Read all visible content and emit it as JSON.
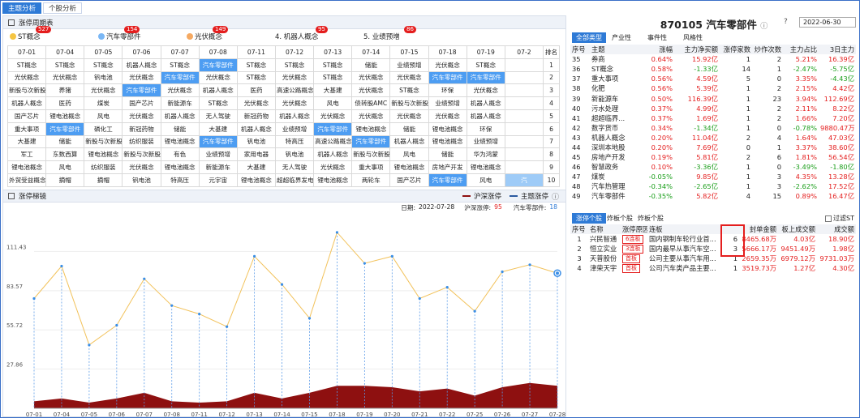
{
  "tabs": [
    "主题分析",
    "个股分析"
  ],
  "left": {
    "section_title": "涨停周期表",
    "themes": [
      {
        "label": "ST概念",
        "badge": "527",
        "dot": "#f5c542"
      },
      {
        "label": "汽车零部件",
        "badge": "154",
        "dot": "#7ab7f5"
      },
      {
        "label": "光伏概念",
        "badge": "149",
        "dot": "#f5a962"
      },
      {
        "label": "4. 机器人概念",
        "badge": "95",
        "dot": ""
      },
      {
        "label": "5. 业绩预增",
        "badge": "86",
        "dot": ""
      }
    ],
    "grid_headers": [
      "07-01",
      "07-04",
      "07-05",
      "07-06",
      "07-07",
      "07-08",
      "07-11",
      "07-12",
      "07-13",
      "07-14",
      "07-15",
      "07-18",
      "07-19",
      "07-2",
      "排名"
    ],
    "grid_rows": [
      [
        "ST概念",
        "ST概念",
        "ST概念",
        "机器人概念",
        "ST概念",
        "汽车零部件",
        "ST概念",
        "ST概念",
        "ST概念",
        "储能",
        "业绩预增",
        "光伏概念",
        "ST概念",
        "",
        "1"
      ],
      [
        "光伏概念",
        "光伏概念",
        "钒电池",
        "光伏概念",
        "汽车零部件",
        "光伏概念",
        "ST概念",
        "光伏概念",
        "ST概念",
        "光伏概念",
        "光伏概念",
        "汽车零部件",
        "汽车零部件",
        "",
        "2"
      ],
      [
        "新股与次新股",
        "养猪",
        "光伏概念",
        "汽车零部件",
        "光伏概念",
        "机器人概念",
        "医药",
        "高速公路概念",
        "大基建",
        "光伏概念",
        "ST概念",
        "环保",
        "光伏概念",
        "",
        "3"
      ],
      [
        "机器人概念",
        "医药",
        "煤炭",
        "国产芯片",
        "新能源车",
        "ST概念",
        "光伏概念",
        "光伏概念",
        "风电",
        "债转股AMC",
        "新股与次新股",
        "业绩预增",
        "机器人概念",
        "",
        "4"
      ],
      [
        "国产芯片",
        "锂电池概念",
        "风电",
        "光伏概念",
        "机器人概念",
        "无人驾驶",
        "新冠药物",
        "机器人概念",
        "光伏概念",
        "光伏概念",
        "光伏概念",
        "光伏概念",
        "机器人概念",
        "",
        "5"
      ],
      [
        "重大事项",
        "汽车零部件",
        "磷化工",
        "新冠药物",
        "储能",
        "大基建",
        "机器人概念",
        "业绩预增",
        "汽车零部件",
        "锂电池概念",
        "储能",
        "锂电池概念",
        "环保",
        "",
        "6"
      ],
      [
        "大基建",
        "储能",
        "新股与次新股",
        "纺织服装",
        "锂电池概念",
        "汽车零部件",
        "钒电池",
        "特高压",
        "高速公路概念",
        "汽车零部件",
        "机器人概念",
        "锂电池概念",
        "业绩预增",
        "",
        "7"
      ],
      [
        "军工",
        "东数西算",
        "锂电池概念",
        "新股与次新股",
        "有色",
        "业绩预增",
        "家用电器",
        "钒电池",
        "机器人概念",
        "新股与次新股",
        "风电",
        "储能",
        "华为鸿蒙",
        "",
        "8"
      ],
      [
        "锂电池概念",
        "风电",
        "纺织服装",
        "光伏概念",
        "锂电池概念",
        "新能源车",
        "大基建",
        "无人驾驶",
        "光伏概念",
        "重大事项",
        "锂电池概念",
        "房地产开发",
        "锂电池概念",
        "",
        "9"
      ],
      [
        "外贸受益概念",
        "摘帽",
        "摘帽",
        "钒电池",
        "特高压",
        "元宇宙",
        "锂电池概念",
        "超超临界发电",
        "锂电池概念",
        "两轮车",
        "国产芯片",
        "汽车零部件",
        "风电",
        "汽",
        "10"
      ]
    ],
    "chart_title": "涨停梯镜",
    "legend": {
      "series1": "沪深涨停",
      "series2": "主题涨停"
    },
    "info": {
      "date_label": "日期:",
      "date": "2022-07-28",
      "hs_label": "沪深涨停:",
      "hs_value": "95",
      "theme_label": "汽车零部件:",
      "theme_value": "18"
    }
  },
  "chart_data": {
    "type": "line",
    "x": [
      "07-01",
      "07-04",
      "07-05",
      "07-06",
      "07-07",
      "07-08",
      "07-11",
      "07-12",
      "07-13",
      "07-14",
      "07-15",
      "07-18",
      "07-19",
      "07-20",
      "07-21",
      "07-22",
      "07-25",
      "07-26",
      "07-27",
      "07-28"
    ],
    "yticks": [
      "27.86",
      "55.72",
      "83.57",
      "111.43"
    ],
    "ylim": [
      0,
      139.3
    ],
    "series": [
      {
        "name": "沪深涨停",
        "type": "area",
        "color": "#8e1010",
        "values": [
          5,
          7,
          4,
          7,
          11,
          5,
          4,
          5,
          11,
          7,
          11,
          16,
          16,
          15,
          12,
          14,
          9,
          15,
          18,
          16
        ]
      },
      {
        "name": "主题涨停",
        "type": "line",
        "color": "#f2c25b",
        "values": [
          78,
          101,
          45,
          59,
          92,
          73,
          67,
          58,
          108,
          88,
          64,
          125,
          103,
          108,
          78,
          86,
          69,
          97,
          102,
          96
        ]
      }
    ]
  },
  "right": {
    "code": "870105",
    "name": "汽车零部件",
    "info_icon": "ⓘ",
    "date_value": "2022-06-30",
    "tabs1": [
      "全部类型",
      "产业性",
      "事件性",
      "风格性"
    ],
    "board_headers": [
      "序号",
      "主题",
      "涨幅",
      "主力净买额",
      "涨停家数",
      "炒作次数",
      "主力占比",
      "3日主力"
    ],
    "board_rows": [
      [
        "35",
        "券商",
        "0.64%",
        "15.92亿",
        "1",
        "2",
        "5.21%",
        "16.39亿"
      ],
      [
        "36",
        "ST概念",
        "0.58%",
        "-1.33亿",
        "14",
        "1",
        "-2.47%",
        "-5.75亿"
      ],
      [
        "37",
        "重大事项",
        "0.56%",
        "4.59亿",
        "5",
        "0",
        "3.35%",
        "-4.43亿"
      ],
      [
        "38",
        "化肥",
        "0.56%",
        "5.39亿",
        "1",
        "2",
        "2.15%",
        "4.42亿"
      ],
      [
        "39",
        "新能源车",
        "0.50%",
        "116.39亿",
        "1",
        "23",
        "3.94%",
        "112.69亿"
      ],
      [
        "40",
        "污水处理",
        "0.37%",
        "4.99亿",
        "1",
        "2",
        "2.11%",
        "8.22亿"
      ],
      [
        "41",
        "超超临界...",
        "0.37%",
        "1.69亿",
        "1",
        "2",
        "1.66%",
        "7.20亿"
      ],
      [
        "42",
        "数字货币",
        "0.34%",
        "-1.34亿",
        "1",
        "0",
        "-0.78%",
        "9880.47万"
      ],
      [
        "43",
        "机器人概念",
        "0.20%",
        "11.04亿",
        "2",
        "4",
        "1.64%",
        "47.03亿"
      ],
      [
        "44",
        "深圳本地股",
        "0.20%",
        "7.69亿",
        "0",
        "1",
        "3.37%",
        "38.60亿"
      ],
      [
        "45",
        "房地产开发",
        "0.19%",
        "5.81亿",
        "2",
        "6",
        "1.81%",
        "56.54亿"
      ],
      [
        "46",
        "智慧政务",
        "0.10%",
        "-3.36亿",
        "1",
        "0",
        "-3.49%",
        "-1.80亿"
      ],
      [
        "47",
        "煤炭",
        "-0.05%",
        "9.85亿",
        "1",
        "3",
        "4.35%",
        "13.28亿"
      ],
      [
        "48",
        "汽车热管理",
        "-0.34%",
        "-2.65亿",
        "1",
        "3",
        "-2.62%",
        "17.52亿"
      ],
      [
        "49",
        "汽车零部件",
        "-0.35%",
        "5.82亿",
        "4",
        "15",
        "0.89%",
        "16.47亿"
      ]
    ],
    "tabs2": [
      "涨停个股",
      "炸板个股",
      "炸板个股"
    ],
    "filter_st": "过滤ST",
    "stock_headers": [
      "序号",
      "名称",
      "涨停原因",
      "连板",
      "封单金额",
      "板上成交额",
      "成交额"
    ],
    "stock_rows": [
      [
        "1",
        "兴民智通",
        "6连板",
        "国内钢制车轮行业首...",
        "6",
        "8465.68万",
        "4.03亿",
        "18.90亿"
      ],
      [
        "2",
        "恒立实业",
        "3连板",
        "国内最早从事汽车空...",
        "3",
        "5666.17万",
        "9451.49万",
        "1.98亿"
      ],
      [
        "3",
        "天普股份",
        "首板",
        "公司主要从事汽车用...",
        "1",
        "2659.35万",
        "6979.12万",
        "9731.03万"
      ],
      [
        "4",
        "津荣天宇",
        "首板",
        "公司汽车类产品主要...",
        "1",
        "3519.73万",
        "1.27亿",
        "4.30亿"
      ]
    ]
  }
}
